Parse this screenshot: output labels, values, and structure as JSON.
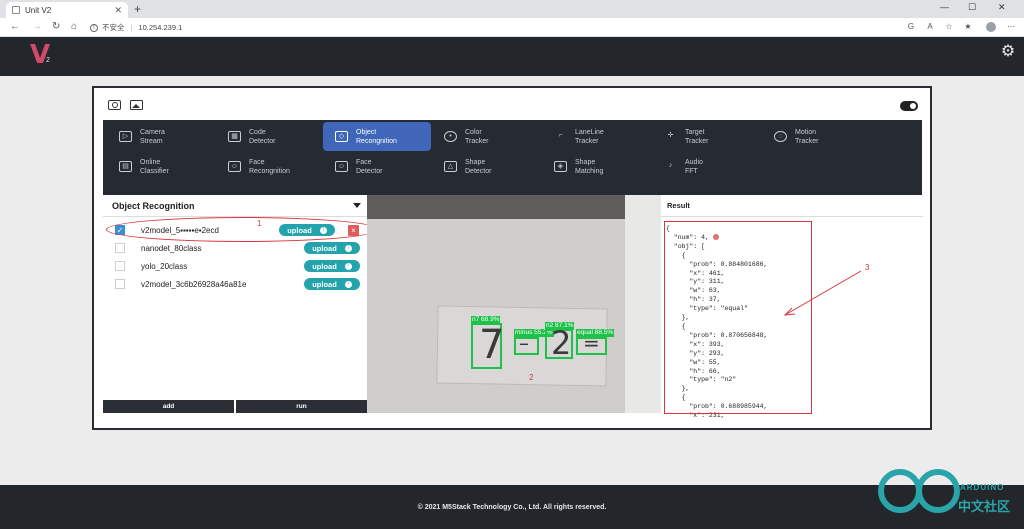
{
  "browser": {
    "tab_title": "Unit V2",
    "new_tab": "+",
    "insecure_label": "不安全",
    "url": "10.254.239.1"
  },
  "app": {
    "logo": "V",
    "logo_sub": "2"
  },
  "functions": [
    {
      "label1": "Camera",
      "label2": "Stream",
      "icon": "play-box-icon"
    },
    {
      "label1": "Code",
      "label2": "Detector",
      "icon": "qr-scan-icon"
    },
    {
      "label1": "Object",
      "label2": "Recongnition",
      "icon": "cube-icon",
      "active": true
    },
    {
      "label1": "Color",
      "label2": "Tracker",
      "icon": "palette-icon"
    },
    {
      "label1": "LaneLine",
      "label2": "Tracker",
      "icon": "laneline-icon"
    },
    {
      "label1": "Target",
      "label2": "Tracker",
      "icon": "crosshair-icon"
    },
    {
      "label1": "Motion",
      "label2": "Tracker",
      "icon": "motion-icon"
    },
    {
      "label1": "Online",
      "label2": "Classifier",
      "icon": "classifier-icon"
    },
    {
      "label1": "Face",
      "label2": "Recongnition",
      "icon": "face-scan-icon"
    },
    {
      "label1": "Face",
      "label2": "Detector",
      "icon": "face-detect-icon"
    },
    {
      "label1": "Shape",
      "label2": "Detector",
      "icon": "shapes-icon"
    },
    {
      "label1": "Shape",
      "label2": "Matching",
      "icon": "shape-match-icon"
    },
    {
      "label1": "Audio",
      "label2": "FFT",
      "icon": "audio-icon"
    }
  ],
  "object_recognition": {
    "title": "Object Recognition",
    "models": [
      {
        "name": "v2model_5▪▪▪▪▪e▪2ecd",
        "checked": true,
        "upload": "upload",
        "deletable": true
      },
      {
        "name": "nanodet_80class",
        "checked": false,
        "upload": "upload"
      },
      {
        "name": "yolo_20class",
        "checked": false,
        "upload": "upload"
      },
      {
        "name": "v2model_3c6b26928a46a81e",
        "checked": false,
        "upload": "upload"
      }
    ],
    "add_label": "add",
    "run_label": "run"
  },
  "detections": [
    {
      "label": "n7 68.9%"
    },
    {
      "label": "minus 55.2%"
    },
    {
      "label": "n2 87.1%"
    },
    {
      "label": "equal 88.5%"
    }
  ],
  "annotations": {
    "one": "1",
    "two": "2",
    "three": "3"
  },
  "result": {
    "title": "Result",
    "lines": [
      "{",
      "  \"num\": 4,",
      "  \"obj\": [",
      "    {",
      "      \"prob\": 0.884801686,",
      "      \"x\": 461,",
      "      \"y\": 311,",
      "      \"w\": 63,",
      "      \"h\": 37,",
      "      \"type\": \"equal\"",
      "    },",
      "    {",
      "      \"prob\": 0.870656848,",
      "      \"x\": 393,",
      "      \"y\": 293,",
      "      \"w\": 55,",
      "      \"h\": 66,",
      "      \"type\": \"n2\"",
      "    },",
      "    {",
      "      \"prob\": 0.688985944,",
      "      \"x\": 231,"
    ]
  },
  "footer": {
    "copyright": "© 2021 M5Stack Technology Co., Ltd. All rights reserved."
  },
  "watermark": {
    "text": "ARDUINO",
    "cn": "中文社区"
  }
}
